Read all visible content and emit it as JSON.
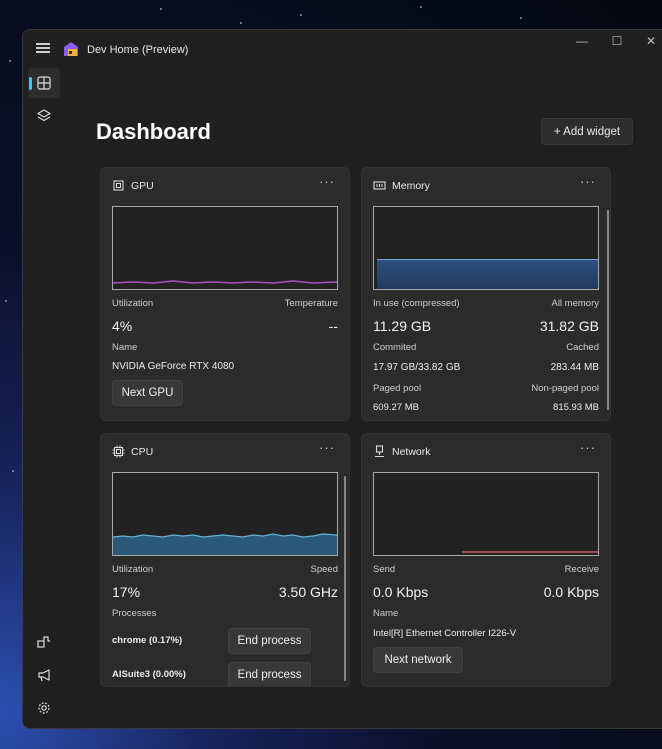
{
  "app": {
    "title": "Dev Home (Preview)"
  },
  "window_controls": {
    "minimize": "—",
    "maximize": "☐",
    "close": "✕"
  },
  "page": {
    "title": "Dashboard",
    "add_widget_label": "+ Add widget"
  },
  "widgets": {
    "gpu": {
      "title": "GPU",
      "more": "···",
      "utilization_label": "Utilization",
      "utilization_value": "4%",
      "temperature_label": "Temperature",
      "temperature_value": "--",
      "name_label": "Name",
      "name_value": "NVIDIA GeForce RTX 4080",
      "button_label": "Next GPU"
    },
    "memory": {
      "title": "Memory",
      "more": "···",
      "inuse_label": "In use (compressed)",
      "inuse_value": "11.29 GB",
      "all_label": "All memory",
      "all_value": "31.82 GB",
      "committed_label": "Commited",
      "committed_value": "17.97 GB/33.82 GB",
      "cached_label": "Cached",
      "cached_value": "283.44 MB",
      "paged_label": "Paged pool",
      "paged_value": "609.27 MB",
      "nonpaged_label": "Non-paged pool",
      "nonpaged_value": "815.93 MB",
      "usage_fraction": 0.35
    },
    "cpu": {
      "title": "CPU",
      "more": "···",
      "utilization_label": "Utilization",
      "utilization_value": "17%",
      "speed_label": "Speed",
      "speed_value": "3.50 GHz",
      "processes_label": "Processes",
      "processes": [
        {
          "name": "chrome (0.17%)",
          "button": "End process"
        },
        {
          "name": "AISuite3 (0.00%)",
          "button": "End process"
        }
      ]
    },
    "network": {
      "title": "Network",
      "more": "···",
      "send_label": "Send",
      "send_value": "0.0 Kbps",
      "receive_label": "Receive",
      "receive_value": "0.0 Kbps",
      "name_label": "Name",
      "name_value": "Intel[R] Ethernet Controller I226-V",
      "button_label": "Next network"
    }
  },
  "colors": {
    "gpu_line": "#b04cc8",
    "cpu_fill": "#2a5a78",
    "cpu_line": "#5fb4d8",
    "memory_fill": "#27476b",
    "memory_line": "#7aa7d6",
    "network_line": "#d0546a",
    "accent": "#4cc2ff"
  }
}
